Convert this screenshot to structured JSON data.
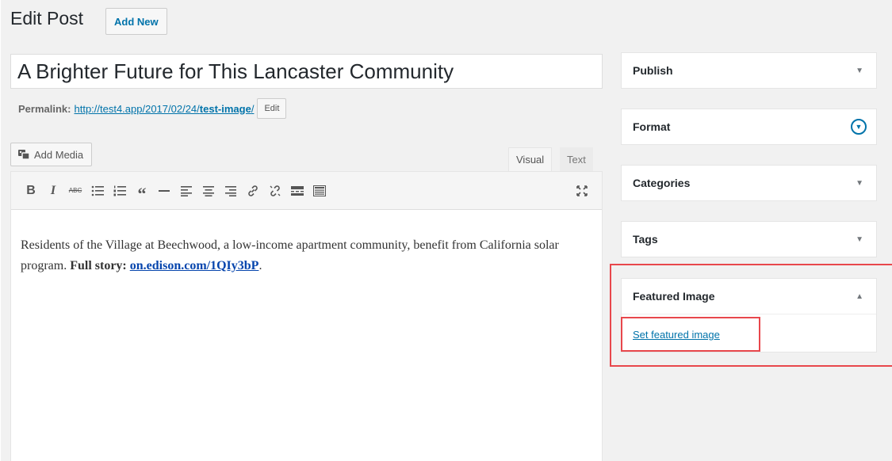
{
  "header": {
    "title": "Edit Post",
    "add_new_label": "Add New"
  },
  "post": {
    "title": "A Brighter Future for This Lancaster Community",
    "permalink_label": "Permalink:",
    "permalink_base": "http://test4.app/2017/02/24/",
    "permalink_slug": "test-image",
    "permalink_trailing": "/",
    "permalink_edit_label": "Edit"
  },
  "editor": {
    "add_media_label": "Add Media",
    "tabs": [
      {
        "label": "Visual",
        "active": true
      },
      {
        "label": "Text",
        "active": false
      }
    ],
    "toolbar": [
      "bold-icon",
      "italic-icon",
      "strikethrough-icon",
      "bulleted-list-icon",
      "numbered-list-icon",
      "blockquote-icon",
      "horizontal-line-icon",
      "align-left-icon",
      "align-center-icon",
      "align-right-icon",
      "insert-link-icon",
      "remove-link-icon",
      "read-more-icon",
      "toolbar-toggle-icon",
      "fullscreen-icon"
    ],
    "content_text": "Residents of the Village at Beechwood, a low-income apartment community, benefit from California solar program.",
    "content_bold": "Full story:",
    "content_link": "on.edison.com/1QIy3bP",
    "content_end": "."
  },
  "sidebar": {
    "publish": "Publish",
    "format": "Format",
    "categories": "Categories",
    "tags": "Tags",
    "featured_image": "Featured Image",
    "set_featured_image": "Set featured image"
  },
  "colors": {
    "accent": "#0073aa",
    "highlight": "#e8474c",
    "background": "#f1f1f1"
  }
}
